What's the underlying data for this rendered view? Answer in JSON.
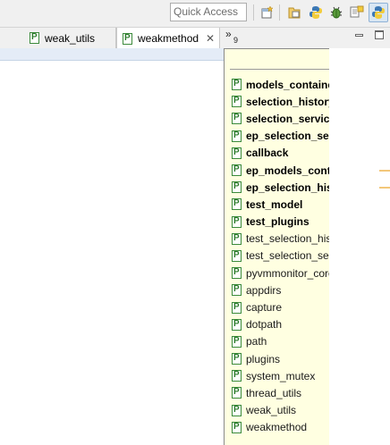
{
  "toolbar": {
    "quick_access_placeholder": "Quick Access",
    "icons": [
      "open-perspective-icon",
      "resource-perspective-icon",
      "pydev-perspective-icon",
      "debug-perspective-icon",
      "python-perspective-icon"
    ]
  },
  "tabs": [
    {
      "label": "weak_utils",
      "active": false
    },
    {
      "label": "weakmethod",
      "active": true
    }
  ],
  "tab_overflow": {
    "count": "9"
  },
  "popup": {
    "items": [
      {
        "label": "models_container_impl",
        "bold": true
      },
      {
        "label": "selection_history_impl",
        "bold": true
      },
      {
        "label": "selection_service_impl",
        "bold": true
      },
      {
        "label": "ep_selection_service",
        "bold": true
      },
      {
        "label": "callback",
        "bold": true
      },
      {
        "label": "ep_models_container",
        "bold": true
      },
      {
        "label": "ep_selection_history",
        "bold": true
      },
      {
        "label": "test_model",
        "bold": true
      },
      {
        "label": "test_plugins",
        "bold": true
      },
      {
        "label": "test_selection_history",
        "bold": false
      },
      {
        "label": "test_selection_service",
        "bold": false
      },
      {
        "label": "pyvmmonitor_core",
        "bold": false
      },
      {
        "label": "appdirs",
        "bold": false
      },
      {
        "label": "capture",
        "bold": false
      },
      {
        "label": "dotpath",
        "bold": false
      },
      {
        "label": "path",
        "bold": false
      },
      {
        "label": "plugins",
        "bold": false
      },
      {
        "label": "system_mutex",
        "bold": false
      },
      {
        "label": "thread_utils",
        "bold": false
      },
      {
        "label": "weak_utils",
        "bold": false
      },
      {
        "label": "weakmethod",
        "bold": false
      }
    ]
  },
  "colors": {
    "popup_background": "#ffffe1",
    "module_icon": "#2f7d2f"
  }
}
